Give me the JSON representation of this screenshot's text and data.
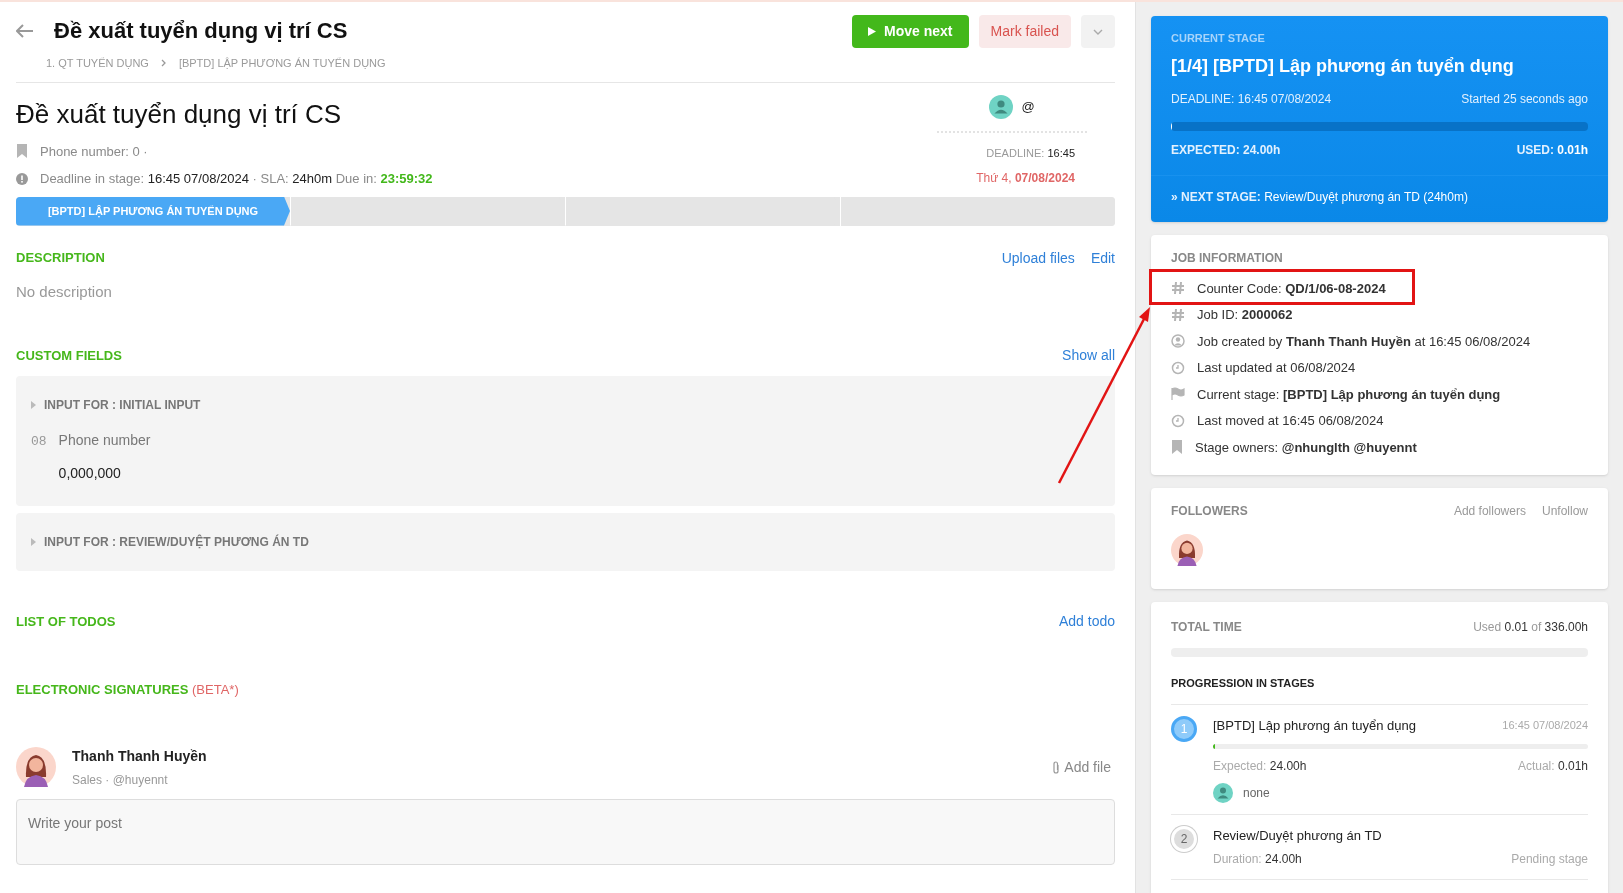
{
  "header": {
    "title": "Đề xuất tuyển dụng vị trí CS",
    "breadcrumbs": [
      "1. QT TUYỂN DỤNG",
      "[BPTD] LẬP PHƯƠNG ÁN TUYỂN DỤNG"
    ],
    "buttons": [
      {
        "kind": "primary",
        "label": "Move next"
      },
      {
        "kind": "danger",
        "label": "Mark failed"
      },
      {
        "kind": "menu"
      }
    ]
  },
  "job": {
    "title": "Đề xuất tuyển dụng vị trí CS",
    "phone_line": "Phone number: 0 ·",
    "deadline_line": {
      "label": "Deadline in stage:",
      "value": "16:45 07/08/2024",
      "sla_label": "· SLA:",
      "sla": "24h0m",
      "due_label": "Due in:",
      "due": "23:59:32"
    },
    "owner": {
      "handle": "@"
    },
    "deadline": {
      "label": "DEADLINE:",
      "time": "16:45",
      "day": "Thứ 4,",
      "date": "07/08/2024"
    }
  },
  "stages": [
    {
      "label": "[BPTD] LẬP PHƯƠNG ÁN TUYỂN DỤNG",
      "selected": true
    },
    {
      "selected": false
    },
    {
      "selected": false
    },
    {
      "selected": false
    }
  ],
  "description": {
    "heading": "DESCRIPTION",
    "actions": [
      "Upload files",
      "Edit"
    ],
    "text": "No description"
  },
  "custom_fields": {
    "heading": "CUSTOM FIELDS",
    "action": "Show all",
    "groups": [
      {
        "title": "INPUT FOR : INITIAL INPUT",
        "fields": [
          {
            "icon": "08",
            "label": "Phone number",
            "value": "0,000,000"
          }
        ]
      },
      {
        "title": "INPUT FOR : REVIEW/DUYỆT PHƯƠNG ÁN TD"
      }
    ]
  },
  "todos": {
    "heading": "LIST OF TODOS",
    "action": "Add todo"
  },
  "signatures": {
    "heading": "ELECTRONIC SIGNATURES",
    "badge": "(BETA*)"
  },
  "post": {
    "author": "Thanh Thanh Huyền",
    "subtitle": "Sales · @huyennt",
    "add_file": "Add file",
    "placeholder": "Write your post"
  },
  "current_stage": {
    "label": "CURRENT STAGE",
    "title": "[1/4] [BPTD] Lập phương án tuyển dụng",
    "deadline": "DEADLINE: 16:45 07/08/2024",
    "started": "Started 25 seconds ago",
    "level": 0.002,
    "expected": "EXPECTED: 24.00h",
    "used_label": "USED:",
    "used": "0.01h",
    "next_label": "» NEXT STAGE:",
    "next": "Review/Duyệt phương án TD (24h0m)"
  },
  "job_information": {
    "heading": "JOB INFORMATION",
    "rows": [
      {
        "kind": "hash",
        "text": "Counter Code: **QD/1/06-08-2024**",
        "highlighted": true
      },
      {
        "kind": "hash",
        "text": "Job ID: **2000062**",
        "highlighted": false
      },
      {
        "kind": "user",
        "text": "Job created by **Thanh Thanh Huyền** at 16:45 06/08/2024",
        "highlighted": false
      },
      {
        "kind": "clock",
        "text": "Last updated at 06/08/2024",
        "highlighted": false
      },
      {
        "kind": "flag",
        "text": "Current stage: **[BPTD] Lập phương án tuyển dụng**",
        "highlighted": false
      },
      {
        "kind": "clock",
        "text": "Last moved at 16:45 06/08/2024",
        "highlighted": false
      },
      {
        "kind": "bookmark",
        "text": "Stage owners: **@nhunglth @huyennt**",
        "highlighted": false
      }
    ]
  },
  "followers": {
    "heading": "FOLLOWERS",
    "actions": [
      "Add followers",
      "Unfollow"
    ]
  },
  "total_time": {
    "heading": "TOTAL TIME",
    "used_label": "Used",
    "used": "0.01",
    "of_label": "of",
    "total": "336.00h",
    "level": 0,
    "progression_heading": "PROGRESSION IN STAGES",
    "stages": [
      {
        "kind": "active",
        "number": "1",
        "title": "[BPTD] Lập phương án tuyển dụng",
        "time": "16:45 07/08/2024",
        "level": 0.003,
        "expected_label": "Expected:",
        "expected": "24.00h",
        "actual_label": "Actual:",
        "actual": "0.01h",
        "owner": "none"
      },
      {
        "kind": "pending",
        "number": "2",
        "title": "Review/Duyệt phương án TD",
        "duration_label": "Duration:",
        "duration": "24.00h",
        "status": "Pending stage"
      }
    ]
  }
}
